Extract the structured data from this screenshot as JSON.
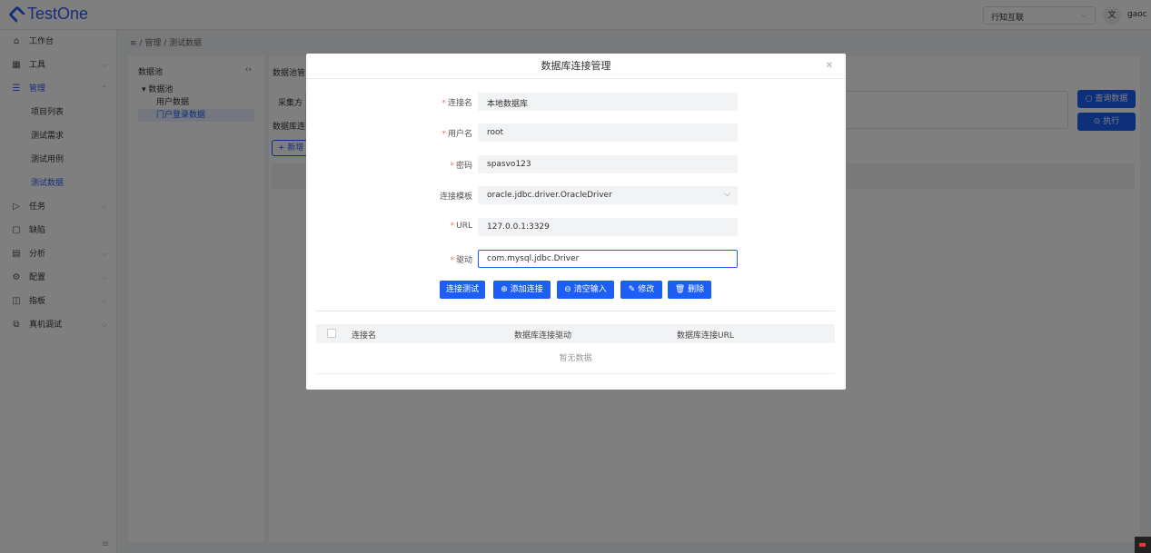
{
  "header": {
    "logo_text": "TestOne",
    "org_select_value": "行知互联",
    "lang_icon": "文",
    "username": "gaoc"
  },
  "sidebar": {
    "items": [
      {
        "label": "工作台",
        "icon": "home-icon"
      },
      {
        "label": "工具",
        "icon": "grid-icon"
      },
      {
        "label": "管理",
        "icon": "list-icon"
      },
      {
        "label": "任务",
        "icon": "play-icon"
      },
      {
        "label": "缺陷",
        "icon": "bug-icon"
      },
      {
        "label": "分析",
        "icon": "calendar-icon"
      },
      {
        "label": "配置",
        "icon": "gear-icon"
      },
      {
        "label": "指板",
        "icon": "board-icon"
      },
      {
        "label": "真机调试",
        "icon": "device-icon"
      }
    ],
    "sub_items": [
      "项目列表",
      "测试需求",
      "测试用例",
      "测试数据"
    ]
  },
  "breadcrumb": {
    "part1": "管理",
    "part2": "测试数据"
  },
  "tree": {
    "title": "数据池",
    "root": "数据池",
    "child1": "用户数据",
    "child2": "门户登录数据"
  },
  "main": {
    "tab_label": "数据池管",
    "collect_label": "采集方",
    "db_label": "数据库连",
    "add_btn": "+ 新增",
    "query_btn": "查询数据",
    "exec_btn": "执行"
  },
  "dialog": {
    "title": "数据库连接管理",
    "fields": {
      "conn_name_label": "连接名",
      "conn_name_value": "本地数据库",
      "user_label": "用户名",
      "user_value": "root",
      "pwd_label": "密码",
      "pwd_value": "spasvo123",
      "template_label": "连接模板",
      "template_value": "oracle.jdbc.driver.OracleDriver",
      "url_label": "URL",
      "url_value": "127.0.0.1:3329",
      "driver_label": "驱动",
      "driver_value": "com.mysql.jdbc.Driver"
    },
    "buttons": {
      "test": "连接测试",
      "add": "添加连接",
      "clear": "清空输入",
      "edit": "修改",
      "delete": "删除"
    },
    "table": {
      "col1": "连接名",
      "col2": "数据库连接驱动",
      "col3": "数据库连接URL",
      "empty": "暂无数据"
    }
  },
  "colors": {
    "primary": "#1d5ff5",
    "required": "#f56c6c"
  }
}
